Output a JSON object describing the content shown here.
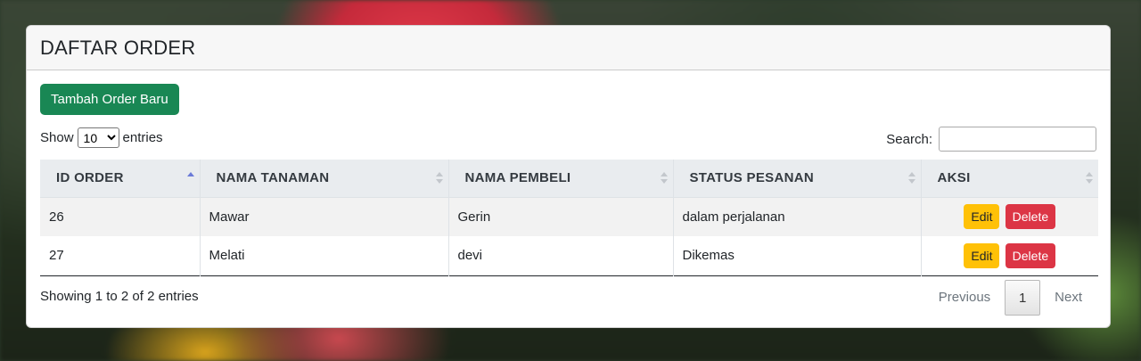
{
  "page": {
    "title": "DAFTAR ORDER",
    "add_button": "Tambah Order Baru"
  },
  "length": {
    "show_label": "Show",
    "selected": "10",
    "entries_label": "entries"
  },
  "search": {
    "label": "Search:",
    "value": ""
  },
  "table": {
    "headers": [
      "ID ORDER",
      "NAMA TANAMAN",
      "NAMA PEMBELI",
      "STATUS PESANAN",
      "AKSI"
    ],
    "rows": [
      {
        "id": "26",
        "tanaman": "Mawar",
        "pembeli": "Gerin",
        "status": "dalam perjalanan"
      },
      {
        "id": "27",
        "tanaman": "Melati",
        "pembeli": "devi",
        "status": "Dikemas"
      }
    ],
    "edit_label": "Edit",
    "delete_label": "Delete"
  },
  "footer": {
    "info": "Showing 1 to 2 of 2 entries",
    "previous": "Previous",
    "current_page": "1",
    "next": "Next"
  },
  "colors": {
    "add_button": "#198754",
    "edit_button": "#ffc107",
    "delete_button": "#dc3545",
    "header_bg": "#e9ecef"
  }
}
